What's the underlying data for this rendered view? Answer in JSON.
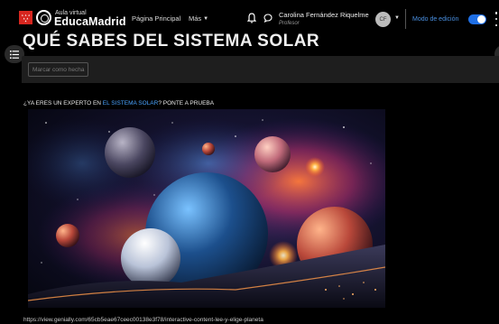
{
  "header": {
    "brand_small": "Aula virtual",
    "brand_name": "EducaMadrid",
    "nav_home": "Página Principal",
    "nav_more": "Más",
    "user_name": "Carolina Fernández Riquelme",
    "user_role": "Profesor",
    "avatar_initials": "CF",
    "edit_mode_label": "Modo de edición",
    "edit_mode_on": true
  },
  "page": {
    "title": "QUÉ SABES DEL SISTEMA SOLAR",
    "mark_done_label": "Marcar como hecha",
    "intro_before": "¿YA ERES UN EXPERTO EN ",
    "intro_link": "EL SISTEMA SOLAR",
    "intro_after": "? PONTE A PRUEBA",
    "url_text": "https://view.genially.com/65cb5eae67ceec00138e3f78/interactive-content-lee-y-elige-planeta"
  },
  "colors": {
    "accent_blue": "#1f6fe5",
    "link_blue": "#4aa3ff",
    "brand_red": "#d7261f"
  },
  "icons": [
    "menu-icon",
    "bell-icon",
    "chat-icon",
    "chevron-down-icon",
    "kebab-icon"
  ]
}
